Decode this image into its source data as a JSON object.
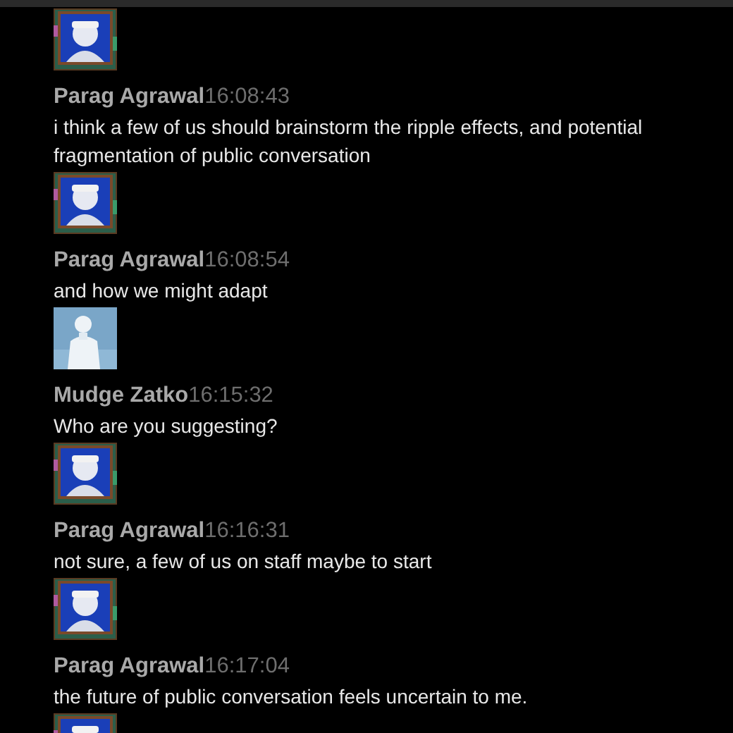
{
  "messages": [
    {
      "kind": "cartoon",
      "author": "Parag Agrawal",
      "time": "16:08:43",
      "text": "i think a few of us should brainstorm the ripple effects, and potential fragmentation of public conversation"
    },
    {
      "kind": "cartoon",
      "author": "Parag Agrawal",
      "time": "16:08:54",
      "text": "and how we might adapt"
    },
    {
      "kind": "photo",
      "author": "Mudge Zatko",
      "time": "16:15:32",
      "text": "Who are you suggesting?"
    },
    {
      "kind": "cartoon",
      "author": "Parag Agrawal",
      "time": "16:16:31",
      "text": "not sure, a few of us on staff maybe to start"
    },
    {
      "kind": "cartoon",
      "author": "Parag Agrawal",
      "time": "16:17:04",
      "text": "the future of public conversation feels uncertain to me."
    },
    {
      "kind": "cartoon"
    }
  ]
}
